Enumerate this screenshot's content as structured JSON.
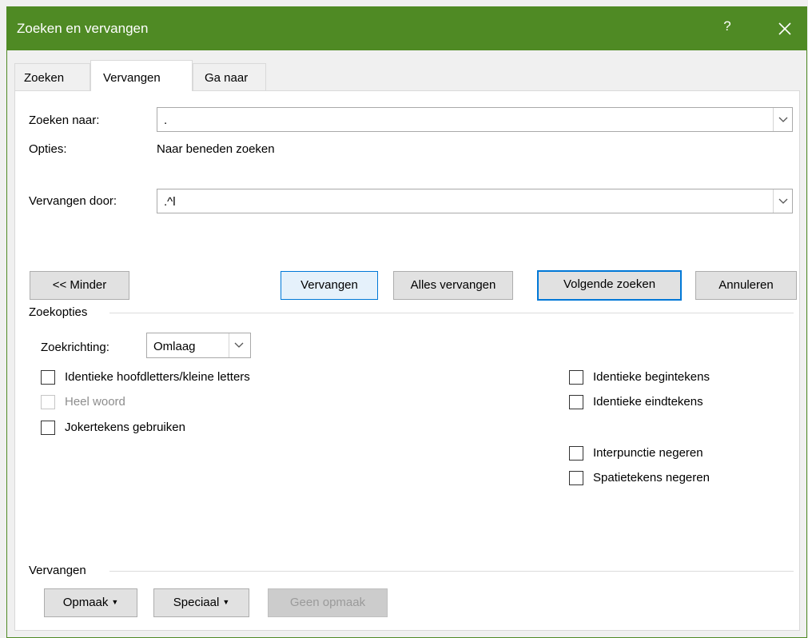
{
  "window": {
    "title": "Zoeken en vervangen",
    "help": "?",
    "accent": "#4f8a24"
  },
  "tabs": [
    {
      "label": "Zoeken",
      "active": false
    },
    {
      "label": "Vervangen",
      "active": true
    },
    {
      "label": "Ga naar",
      "active": false
    }
  ],
  "find": {
    "label": "Zoeken naar:",
    "value": ".",
    "options_label": "Opties:",
    "options_value": "Naar beneden zoeken"
  },
  "replace": {
    "label": "Vervangen door:",
    "value": ".^l"
  },
  "buttons": {
    "less": "<< Minder",
    "replace": "Vervangen",
    "replace_all": "Alles vervangen",
    "find_next": "Volgende zoeken",
    "cancel": "Annuleren"
  },
  "search_options": {
    "heading": "Zoekopties",
    "direction_label": "Zoekrichting:",
    "direction_value": "Omlaag",
    "left_checks": [
      {
        "label": "Identieke hoofdletters/kleine letters",
        "checked": false,
        "enabled": true
      },
      {
        "label": "Heel woord",
        "checked": false,
        "enabled": false
      },
      {
        "label": "Jokertekens gebruiken",
        "checked": false,
        "enabled": true
      }
    ],
    "right_checks": [
      {
        "label": "Identieke begintekens",
        "checked": false,
        "enabled": true
      },
      {
        "label": "Identieke eindtekens",
        "checked": false,
        "enabled": true
      },
      {
        "label": "Interpunctie negeren",
        "checked": false,
        "enabled": true
      },
      {
        "label": "Spatietekens negeren",
        "checked": false,
        "enabled": true
      }
    ]
  },
  "replace_section": {
    "heading": "Vervangen",
    "format": "Opmaak",
    "special": "Speciaal",
    "no_format": "Geen opmaak"
  },
  "icons": {
    "close": "close-icon",
    "dropdown": "chevron-down-icon",
    "menu_caret": "caret-down-icon"
  }
}
